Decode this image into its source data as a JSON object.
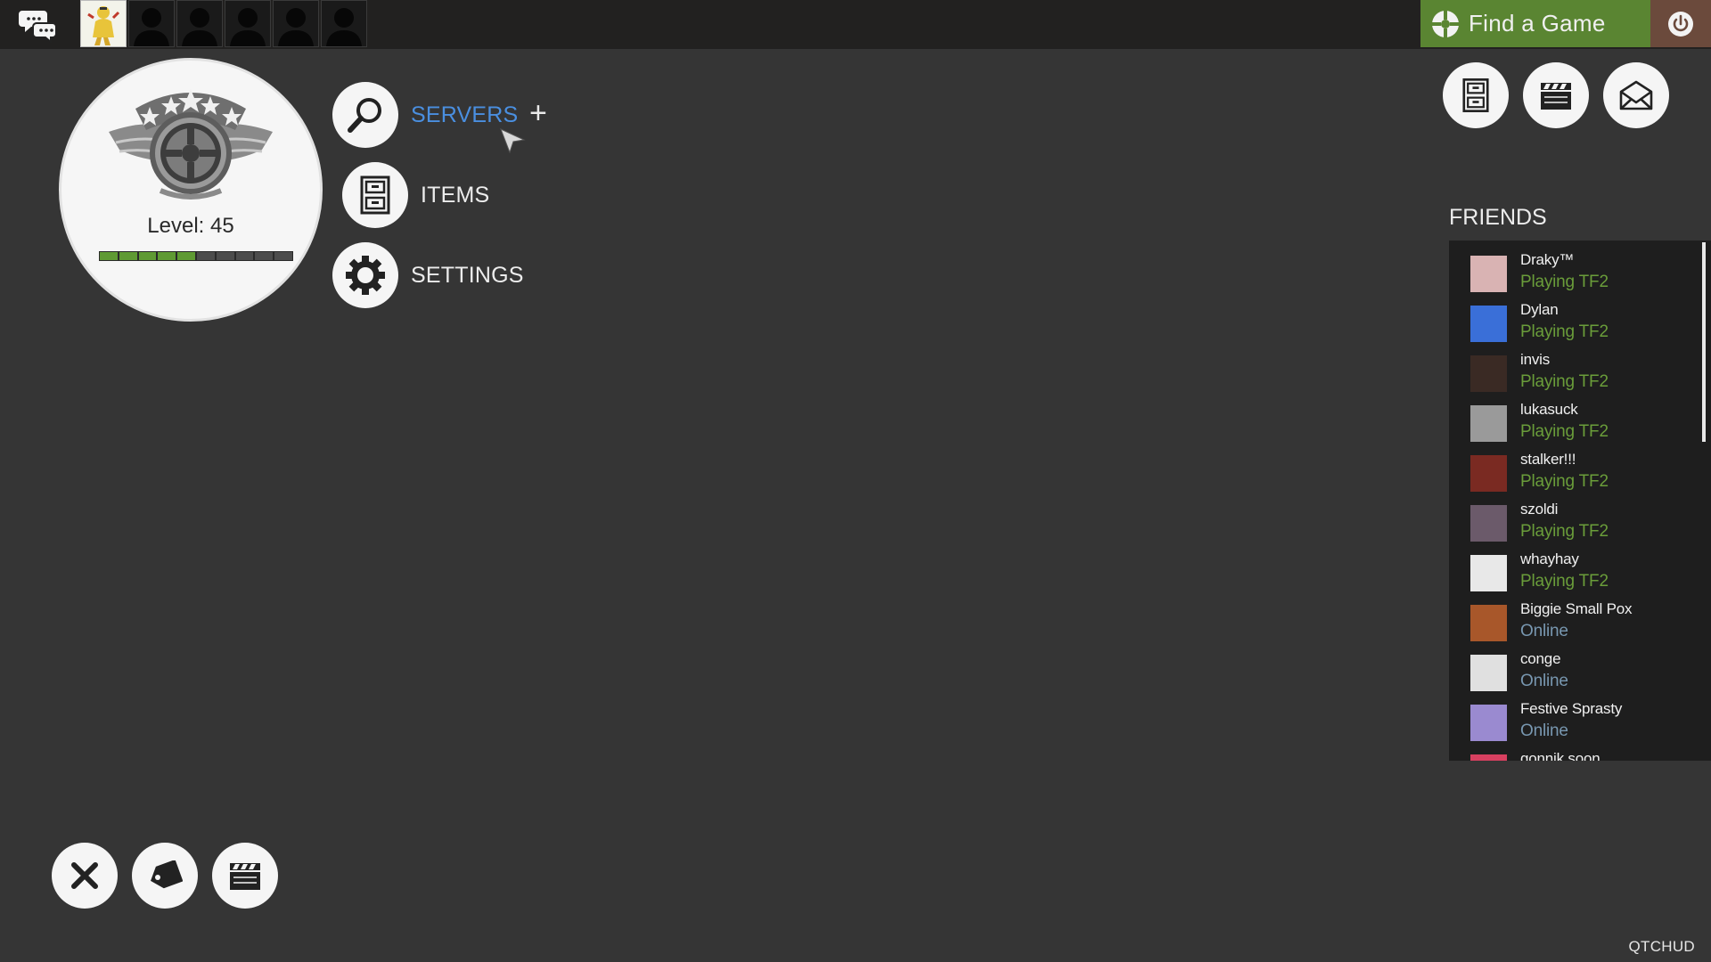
{
  "topbar": {
    "party_slot_count": 6,
    "find_game_label": "Find a Game"
  },
  "profile": {
    "level_text": "Level: 45",
    "xp_progress": 0.5
  },
  "menu": {
    "servers": "SERVERS",
    "items": "ITEMS",
    "settings": "SETTINGS"
  },
  "friends": {
    "title": "FRIENDS",
    "list": [
      {
        "name": "Draky™",
        "status": "Playing TF2",
        "state": "ingame"
      },
      {
        "name": "Dylan",
        "status": "Playing TF2",
        "state": "ingame"
      },
      {
        "name": "invis",
        "status": "Playing TF2",
        "state": "ingame"
      },
      {
        "name": "lukasuck",
        "status": "Playing TF2",
        "state": "ingame"
      },
      {
        "name": "stalker!!!",
        "status": "Playing TF2",
        "state": "ingame"
      },
      {
        "name": "szoldi",
        "status": "Playing TF2",
        "state": "ingame"
      },
      {
        "name": "whayhay",
        "status": "Playing TF2",
        "state": "ingame"
      },
      {
        "name": "Biggie Small Pox",
        "status": "Online",
        "state": "online"
      },
      {
        "name": "conge",
        "status": "Online",
        "state": "online"
      },
      {
        "name": "Festive Sprasty",
        "status": "Online",
        "state": "online"
      },
      {
        "name": "gonnik soon",
        "status": "",
        "state": "online"
      }
    ]
  },
  "colors": {
    "ingame": "#6a9d3a",
    "online": "#7897b0",
    "active_menu": "#4a8fe0",
    "find_game_bg": "#5a8532",
    "power_bg": "#6b4a3c"
  },
  "icons": {
    "chat": "chat-bubbles-icon",
    "find_game": "find-game-icon",
    "power": "power-icon",
    "servers": "magnifier-icon",
    "items": "cabinet-icon",
    "settings": "gear-icon",
    "backpack": "cabinet-icon",
    "replays": "clapperboard-icon",
    "mail": "envelope-icon",
    "quit": "close-icon",
    "store": "price-tag-icon",
    "workshop": "clapperboard-icon"
  },
  "footer": {
    "brand": "QTCHUD"
  }
}
